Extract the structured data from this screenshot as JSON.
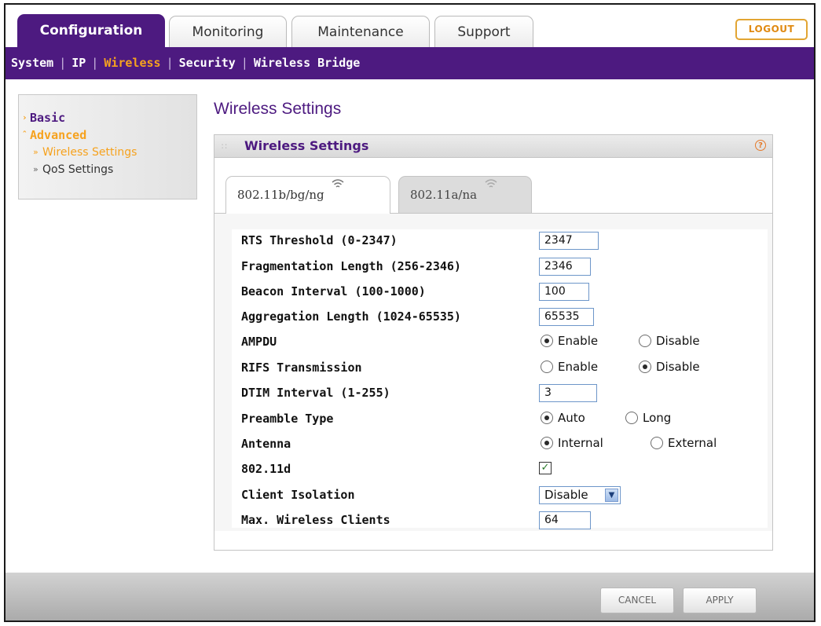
{
  "tabs": [
    {
      "label": "Configuration",
      "active": true
    },
    {
      "label": "Monitoring",
      "active": false
    },
    {
      "label": "Maintenance",
      "active": false
    },
    {
      "label": "Support",
      "active": false
    }
  ],
  "logout_label": "LOGOUT",
  "subnav": [
    {
      "label": "System",
      "active": false
    },
    {
      "label": "IP",
      "active": false
    },
    {
      "label": "Wireless",
      "active": true
    },
    {
      "label": "Security",
      "active": false
    },
    {
      "label": "Wireless Bridge",
      "active": false
    }
  ],
  "sidebar": {
    "basic": "Basic",
    "advanced": "Advanced",
    "wireless_settings": "Wireless Settings",
    "qos_settings": "QoS Settings"
  },
  "page_title": "Wireless Settings",
  "panel_title": "Wireless Settings",
  "radio_tabs": {
    "bgn": "802.11b/bg/ng",
    "ana": "802.11a/na"
  },
  "fields": {
    "rts_label": "RTS Threshold (0-2347)",
    "rts_value": "2347",
    "frag_label": "Fragmentation Length (256-2346)",
    "frag_value": "2346",
    "beacon_label": "Beacon Interval (100-1000)",
    "beacon_value": "100",
    "aggregation_label": "Aggregation Length (1024-65535)",
    "aggregation_value": "65535",
    "ampdu_label": "AMPDU",
    "ampdu_selected": "Enable",
    "rifs_label": "RIFS Transmission",
    "rifs_selected": "Disable",
    "dtim_label": "DTIM Interval (1-255)",
    "dtim_value": "3",
    "preamble_label": "Preamble Type",
    "preamble_selected": "Auto",
    "antenna_label": "Antenna",
    "antenna_selected": "Internal",
    "d80211_label": "802.11d",
    "d80211_checked": true,
    "client_isolation_label": "Client Isolation",
    "client_isolation_value": "Disable",
    "max_clients_label": "Max. Wireless Clients",
    "max_clients_value": "64"
  },
  "options": {
    "enable": "Enable",
    "disable": "Disable",
    "auto": "Auto",
    "long": "Long",
    "internal": "Internal",
    "external": "External"
  },
  "buttons": {
    "cancel": "CANCEL",
    "apply": "APPLY"
  },
  "colors": {
    "brand_purple": "#4d1a80",
    "accent_orange": "#f6a21e"
  }
}
